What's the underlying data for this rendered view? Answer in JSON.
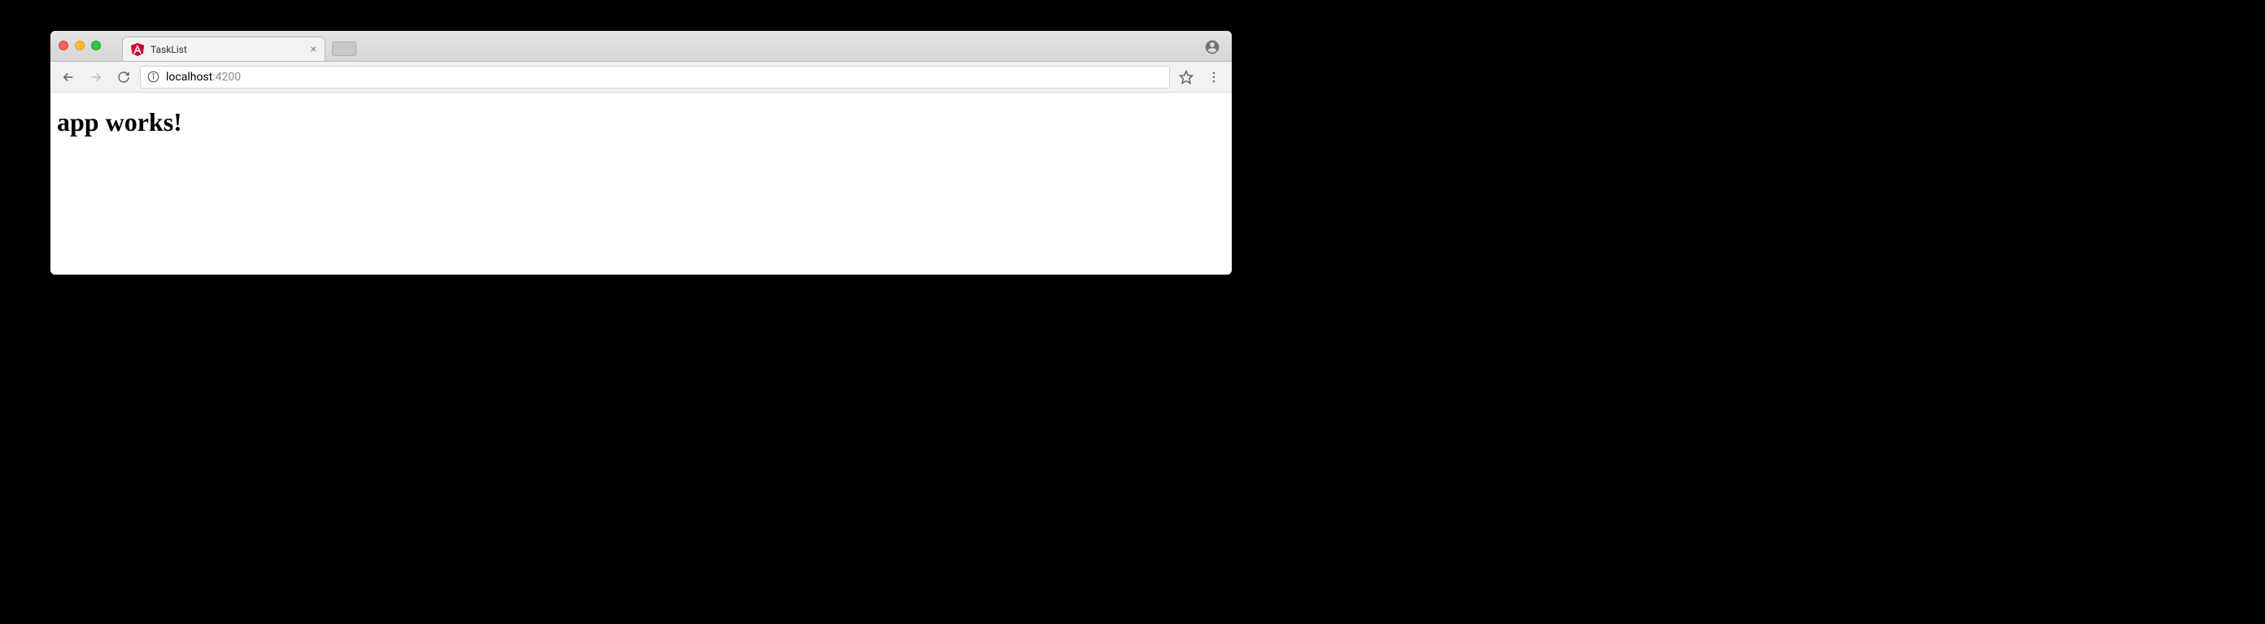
{
  "browser": {
    "tab": {
      "title": "TaskList",
      "close_label": "×"
    },
    "url": {
      "host": "localhost",
      "port": ":4200"
    }
  },
  "page": {
    "heading": "app works!"
  }
}
